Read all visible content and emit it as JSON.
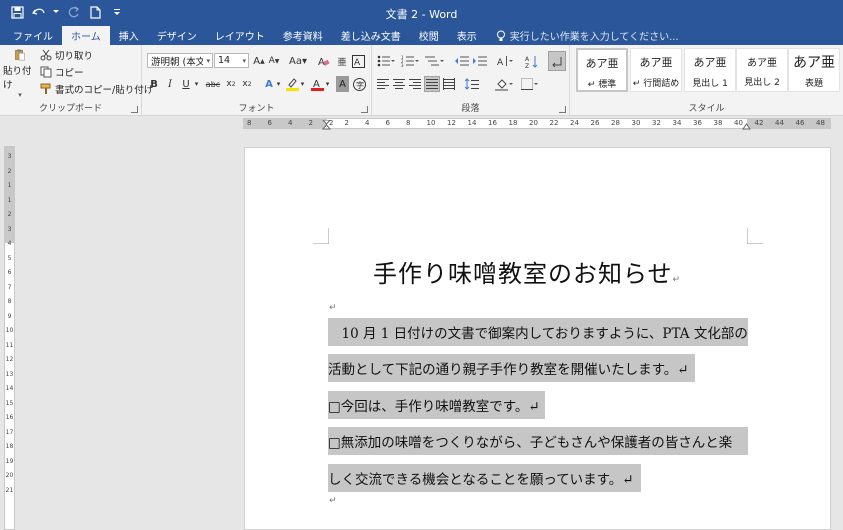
{
  "window": {
    "title": "文書 2 - Word"
  },
  "tabs": [
    {
      "label": "ファイル"
    },
    {
      "label": "ホーム"
    },
    {
      "label": "挿入"
    },
    {
      "label": "デザイン"
    },
    {
      "label": "レイアウト"
    },
    {
      "label": "参考資料"
    },
    {
      "label": "差し込み文書"
    },
    {
      "label": "校閲"
    },
    {
      "label": "表示"
    }
  ],
  "tellme": {
    "placeholder": "実行したい作業を入力してください..."
  },
  "clipboard": {
    "paste_label": "貼り付け",
    "cut_label": "切り取り",
    "copy_label": "コピー",
    "format_painter_label": "書式のコピー/貼り付け",
    "group_label": "クリップボード"
  },
  "font": {
    "name": "游明朝 (本文(",
    "size": "14",
    "group_label": "フォント"
  },
  "paragraph": {
    "group_label": "段落"
  },
  "styles": {
    "group_label": "スタイル",
    "items": [
      {
        "sample": "あア亜",
        "name": "↵ 標準"
      },
      {
        "sample": "あア亜",
        "name": "↵ 行間詰め"
      },
      {
        "sample": "あア亜",
        "name": "見出し 1"
      },
      {
        "sample": "あア亜",
        "name": "見出し 2"
      },
      {
        "sample": "あア亜",
        "name": "表題"
      }
    ]
  },
  "ruler": {
    "h_left_numbers": [
      "8",
      "6",
      "4",
      "2",
      "2"
    ],
    "h_numbers": [
      "2",
      "4",
      "6",
      "8",
      "10",
      "12",
      "14",
      "16",
      "18",
      "20",
      "22",
      "24",
      "26",
      "28",
      "30",
      "32",
      "34",
      "36",
      "38",
      "40",
      "42",
      "44",
      "46",
      "48"
    ],
    "v_numbers": [
      "3",
      "2",
      "1",
      "1",
      "2",
      "3",
      "4",
      "5",
      "6",
      "7",
      "8",
      "9",
      "10",
      "11",
      "12",
      "13",
      "14",
      "15",
      "16",
      "17",
      "18",
      "19",
      "20",
      "21"
    ]
  },
  "document": {
    "title": "手作り味噌教室のお知らせ",
    "para_mark": "↵",
    "lines": [
      "　10 月 1 日付けの文書で御案内しておりますように、PTA 文化部の",
      "活動として下記の通り親子手作り教室を開催いたします。↵",
      "□今回は、手作り味噌教室です。↵",
      "□無添加の味噌をつくりながら、子どもさんや保護者の皆さんと楽",
      "しく交流できる機会となることを願っています。↵"
    ]
  },
  "colors": {
    "brand": "#2b579a",
    "ribbon": "#f3f3f3",
    "selection": "#c6c6c6"
  }
}
